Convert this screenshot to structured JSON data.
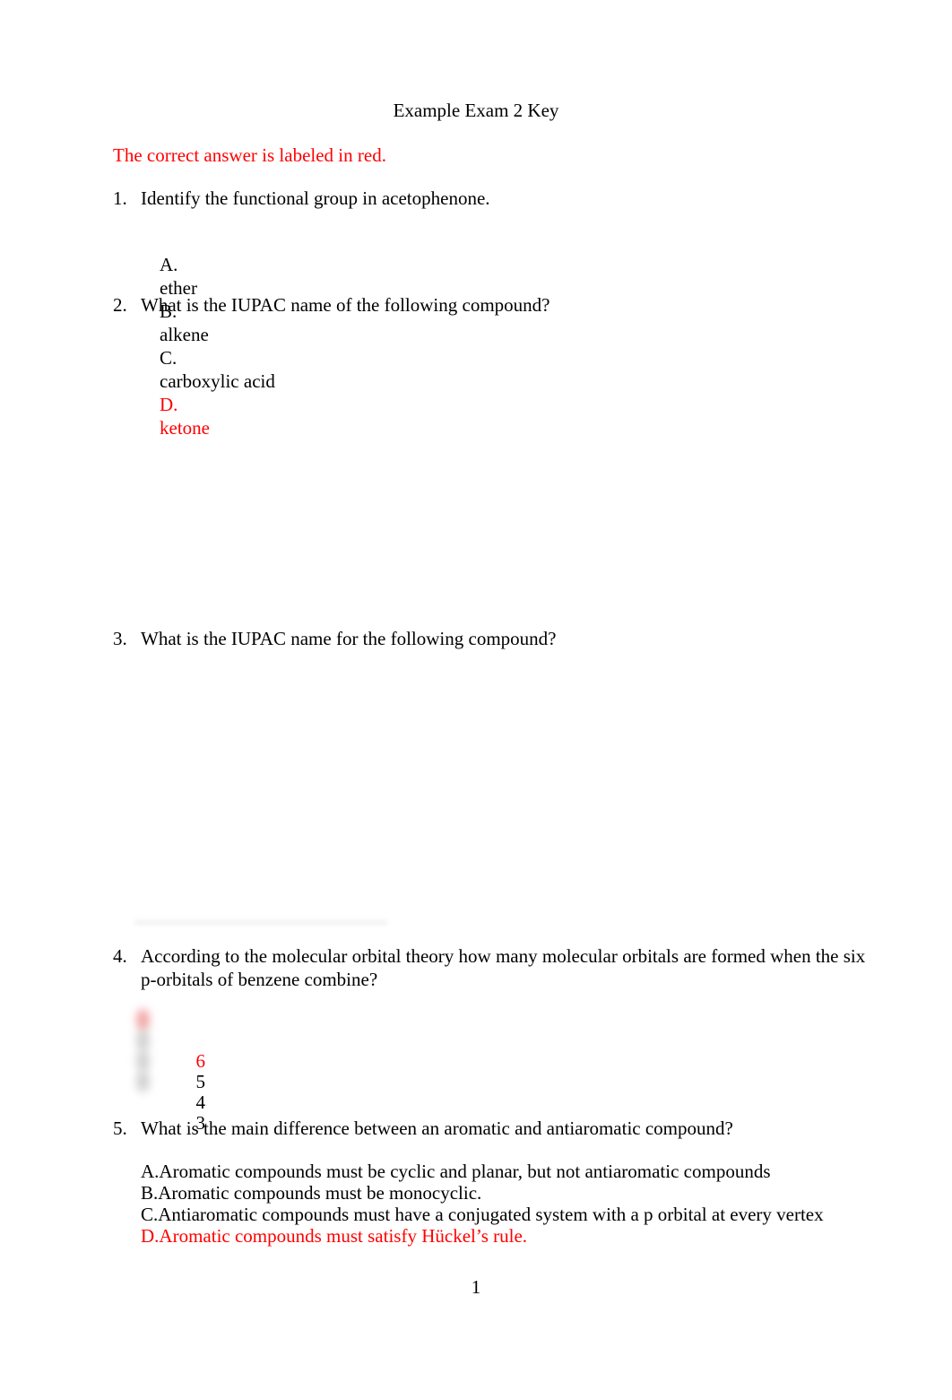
{
  "document": {
    "title": "Example Exam 2 Key",
    "instruction": "The correct answer is labeled in red.",
    "page_number": "1",
    "answer_color": "#ff0000",
    "text_color": "#000000",
    "background_color": "#ffffff"
  },
  "questions": [
    {
      "number": "1.",
      "text": "Identify the functional group in acetophenone.",
      "options": [
        {
          "label": "A.",
          "value": "ether",
          "correct": false
        },
        {
          "label": "B.",
          "value": "alkene",
          "correct": false
        },
        {
          "label": "C.",
          "value": "carboxylic acid",
          "correct": false
        },
        {
          "label": "D.",
          "value": "ketone",
          "correct": true
        }
      ]
    },
    {
      "number": "2.",
      "text": "What is the IUPAC name of the following compound?",
      "figure": {
        "present": false,
        "note": "blank structure image area"
      }
    },
    {
      "number": "3.",
      "text": "What is the IUPAC name for the following compound?",
      "figure": {
        "present": false,
        "note": "blank structure image area"
      }
    },
    {
      "number": "4.",
      "text": "According to the molecular orbital theory how many molecular orbitals are formed when the six p-orbitals of benzene combine?",
      "options": [
        {
          "label": "",
          "value": "6",
          "correct": true
        },
        {
          "label": "",
          "value": "5",
          "correct": false
        },
        {
          "label": "",
          "value": "4",
          "correct": false
        },
        {
          "label": "",
          "value": "3",
          "correct": false
        }
      ]
    },
    {
      "number": "5.",
      "text": "What is the main difference between an aromatic and antiaromatic compound?",
      "options": [
        {
          "label": "A.",
          "value": "A.Aromatic compounds must be cyclic and planar, but not antiaromatic compounds",
          "correct": false
        },
        {
          "label": "B.",
          "value": "B.Aromatic compounds must be monocyclic.",
          "correct": false
        },
        {
          "label": "C.",
          "value": "C.Antiaromatic compounds must have a conjugated system with a p orbital at every vertex",
          "correct": false
        },
        {
          "label": "D.",
          "value": "D.Aromatic compounds must satisfy Hückel’s rule.",
          "correct": true
        }
      ]
    }
  ]
}
